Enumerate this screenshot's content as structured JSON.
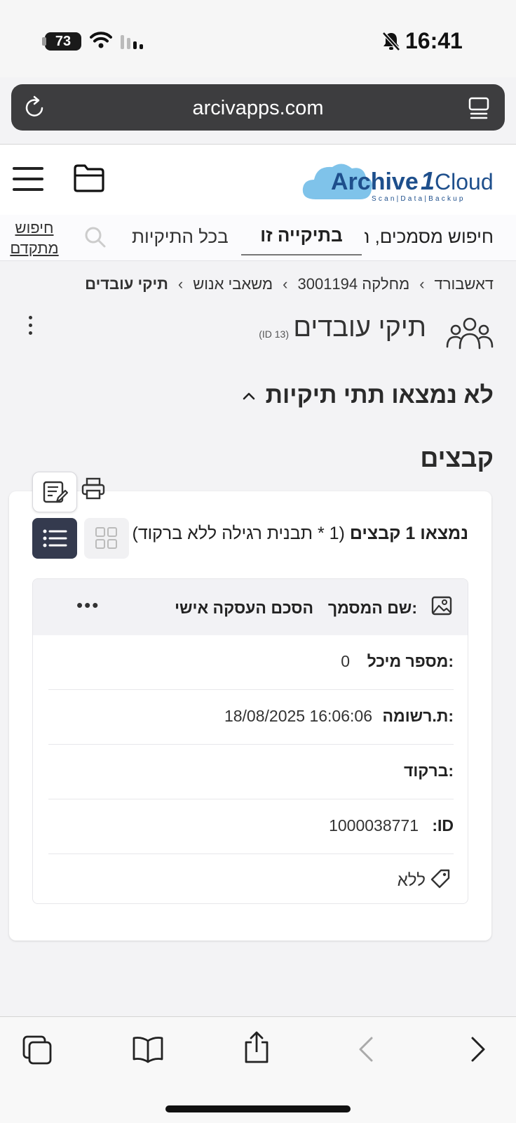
{
  "status_bar": {
    "battery": "73",
    "time": "16:41"
  },
  "browser": {
    "url": "arcivapps.com"
  },
  "header": {
    "logo_text": "Archive1Cloud",
    "logo_tagline": "Scan|Data|Backup"
  },
  "search": {
    "placeholder": "חיפוש מסמכים, ח",
    "tab_this_folder": "בתיקייה זו",
    "tab_all_folders": "בכל התיקיות",
    "advanced": "חיפוש מתקדם"
  },
  "breadcrumb": {
    "items": [
      "דאשבורד",
      "מחלקה 3001194",
      "משאבי אנוש",
      "תיקי עובדים"
    ]
  },
  "page": {
    "title": "תיקי עובדים",
    "id_label": "(ID 13)"
  },
  "subfolders": {
    "heading": "לא נמצאו תתי תיקיות"
  },
  "files": {
    "heading": "קבצים",
    "found_bold": "נמצאו 1 קבצים",
    "found_detail": "(1 * תבנית רגילה ללא ברקוד)"
  },
  "document": {
    "name_label": "שם המסמך:",
    "name_value": "הסכם העסקה אישי",
    "fields": [
      {
        "label": "מספר מיכל:",
        "value": "0"
      },
      {
        "label": "ת.רשומה:",
        "value": "18/08/2025 16:06:06"
      },
      {
        "label": "ברקוד:",
        "value": ""
      },
      {
        "label": "ID:",
        "value": "1000038771"
      }
    ],
    "tag": "ללא"
  },
  "colors": {
    "accent_dark": "#343a4e",
    "logo_blue": "#1e4f8c",
    "cloud": "#7fc3ea"
  }
}
